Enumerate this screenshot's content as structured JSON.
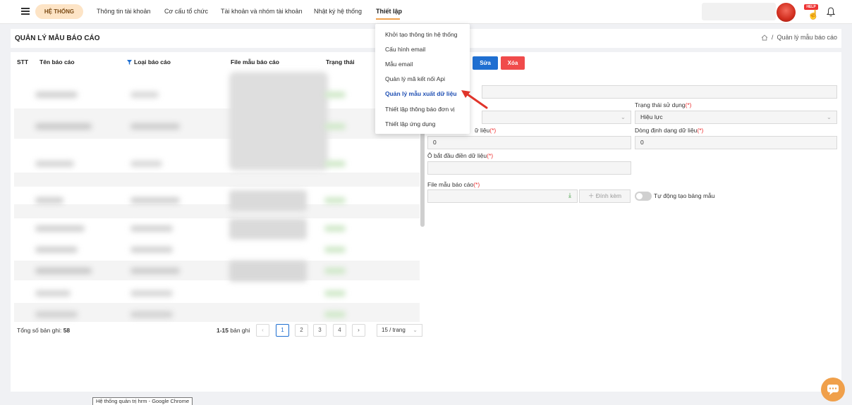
{
  "nav": {
    "system_button": "HỆ THỐNG",
    "items": [
      {
        "label": "Thông tin tài khoản"
      },
      {
        "label": "Cơ cấu tổ chức"
      },
      {
        "label": "Tài khoản và nhóm tài khoản"
      },
      {
        "label": "Nhật ký hệ thống"
      },
      {
        "label": "Thiết lập"
      }
    ],
    "help_badge": "HELP"
  },
  "page": {
    "title": "QUẢN LÝ MẪU BÁO CÁO",
    "breadcrumb_current": "Quản lý mẫu báo cáo"
  },
  "dropdown": {
    "items": [
      {
        "label": "Khởi tạo thông tin hệ thống"
      },
      {
        "label": "Cấu hình email"
      },
      {
        "label": "Mẫu email"
      },
      {
        "label": "Quản lý mã kết nối Api"
      },
      {
        "label": "Quản lý mẫu xuất dữ liệu"
      },
      {
        "label": "Thiết lập thông báo đơn vị"
      },
      {
        "label": "Thiết lập ứng dụng"
      }
    ],
    "active_index": 4
  },
  "table": {
    "headers": [
      "STT",
      "Tên báo cáo",
      "Loại báo cáo",
      "File mẫu báo cáo",
      "Trạng thái"
    ],
    "total_label": "Tổng số bản ghi:",
    "total_value": "58",
    "range_value": "1-15",
    "range_suffix": "bản ghi",
    "pages": [
      "1",
      "2",
      "3",
      "4"
    ],
    "per_page": "15 / trang"
  },
  "form": {
    "edit_button": "Sửa",
    "delete_button": "Xóa",
    "status_label": "Trạng thái sử dụng",
    "status_value": "Hiệu lực",
    "data_col_label": "ữ liệu",
    "data_col_value": "0",
    "format_row_label": "Dòng định dạng dữ liệu",
    "format_row_value": "0",
    "start_cell_label": "Ô bắt đầu điền dữ liệu",
    "file_label": "File mẫu báo cáo",
    "attach_button": "Đính kèm",
    "auto_create_label": "Tự động tạo bảng mẫu",
    "required_mark": "(*)"
  },
  "tooltip": {
    "text": "Hệ thống quản trị hrm - Google Chrome"
  },
  "colors": {
    "accent_orange": "#f0a04b",
    "primary_blue": "#1f6fd1",
    "danger_red": "#f04b4b",
    "active_menu": "#1f4fb3"
  }
}
